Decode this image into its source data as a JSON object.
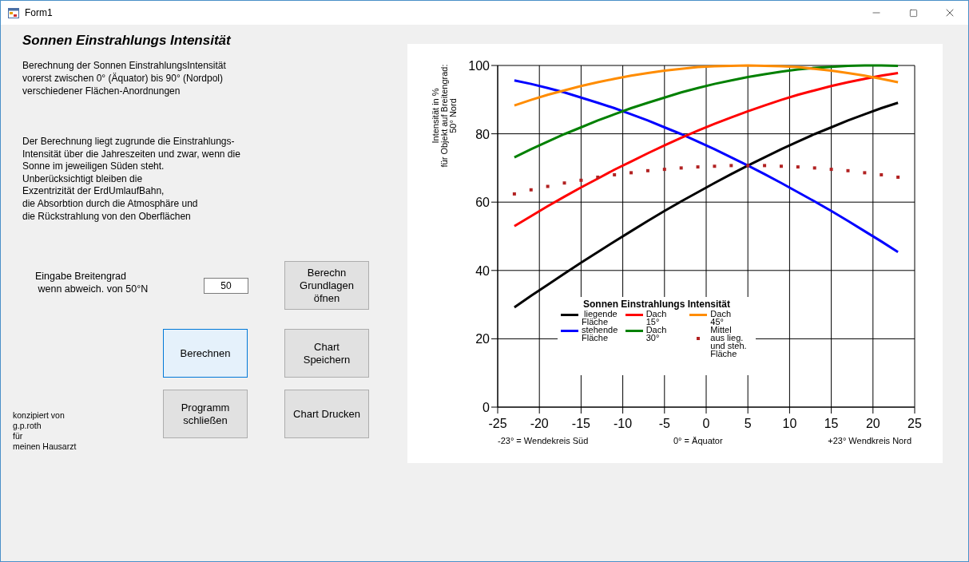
{
  "window": {
    "title": "Form1"
  },
  "heading": "Sonnen Einstrahlungs Intensität",
  "intro": "Berechnung der Sonnen EinstrahlungsIntensität\nvorerst zwischen 0° (Äquator) bis 90° (Nordpol)\nverschiedener Flächen-Anordnungen",
  "description": "Der Berechnung liegt zugrunde die Einstrahlungs-\nIntensität über die Jahreszeiten und zwar, wenn die\nSonne  im jeweiligen Süden steht.\nUnberücksichtigt bleiben die\nExzentrizität der ErdUmlaufBahn,\ndie Absorbtion durch die Atmosphäre und\ndie Rückstrahlung von den Oberflächen",
  "latitude": {
    "label": "Eingabe Breitengrad\n wenn abweich. von 50°N",
    "value": "50"
  },
  "buttons": [
    {
      "label": "Berechn\nGrundlagen\nöfnen",
      "focused": false
    },
    {
      "label": "Berechnen",
      "focused": true
    },
    {
      "label": "Chart\nSpeichern",
      "focused": false
    },
    {
      "label": "Programm\nschließen",
      "focused": false
    },
    {
      "label": "Chart Drucken",
      "focused": false
    }
  ],
  "credits": "konzipiert von\ng.p.roth\nfür\nmeinen Hausarzt",
  "chart": {
    "legend_title": "Sonnen Einstrahlungs Intensität",
    "notes": [
      "-23° = Wendekreis Süd",
      "0° = Äquator",
      "+23° Wendkreis Nord"
    ],
    "chart_data": {
      "type": "line",
      "grid": true,
      "legend": true,
      "ylabel": "Intensität in %\nfür Objekt auf Breitengrad:\n50° Nord",
      "xlim": [
        -25,
        25
      ],
      "ylim": [
        0,
        100
      ],
      "xticks": [
        -25,
        -20,
        -15,
        -10,
        -5,
        0,
        5,
        10,
        15,
        20,
        25
      ],
      "yticks": [
        0,
        20,
        40,
        60,
        80,
        100
      ],
      "x": [
        -23,
        -21,
        -19,
        -17,
        -15,
        -13,
        -11,
        -9,
        -7,
        -5,
        -3,
        -1,
        1,
        3,
        5,
        7,
        9,
        11,
        13,
        15,
        17,
        19,
        21,
        23
      ],
      "series": [
        {
          "name": " liegende\nFläche",
          "color": "#000000",
          "values": [
            29.2,
            32.6,
            35.8,
            39.1,
            42.3,
            45.4,
            48.5,
            51.5,
            54.5,
            57.4,
            60.2,
            62.9,
            65.6,
            68.2,
            70.7,
            73.1,
            75.5,
            77.7,
            79.9,
            81.9,
            83.9,
            85.7,
            87.5,
            89.1
          ]
        },
        {
          "name": "stehende\nFläche",
          "color": "#0000ff",
          "values": [
            95.6,
            94.6,
            93.4,
            92.1,
            90.6,
            89.1,
            87.5,
            85.7,
            83.9,
            81.9,
            79.9,
            77.7,
            75.5,
            73.1,
            70.7,
            68.2,
            65.6,
            62.9,
            60.2,
            57.4,
            54.5,
            51.5,
            48.5,
            45.4
          ]
        },
        {
          "name": "Dach\n15°",
          "color": "#ff0000",
          "values": [
            53.0,
            55.9,
            58.8,
            61.6,
            64.3,
            66.9,
            69.5,
            71.9,
            74.3,
            76.6,
            78.8,
            80.9,
            82.9,
            84.8,
            86.6,
            88.3,
            89.9,
            91.4,
            92.7,
            94.0,
            95.1,
            96.1,
            97.0,
            97.8
          ]
        },
        {
          "name": "Dach\n30°",
          "color": "#008000",
          "values": [
            73.1,
            75.5,
            77.7,
            79.9,
            81.9,
            83.9,
            85.7,
            87.5,
            89.1,
            90.6,
            92.1,
            93.4,
            94.6,
            95.6,
            96.6,
            97.4,
            98.2,
            98.8,
            99.3,
            99.6,
            99.9,
            100.0,
            100.0,
            99.9
          ]
        },
        {
          "name": "Dach\n45°",
          "color": "#ff8c00",
          "values": [
            88.3,
            89.9,
            91.4,
            92.7,
            94.0,
            95.1,
            96.1,
            97.0,
            97.8,
            98.5,
            99.0,
            99.5,
            99.8,
            99.9,
            100.0,
            99.9,
            99.8,
            99.5,
            99.0,
            98.5,
            97.8,
            97.0,
            96.1,
            95.1
          ]
        },
        {
          "name": "Mittel\naus lieg.\nund steh.\nFläche",
          "color": "#b22222",
          "type": "scatter",
          "values": [
            62.4,
            63.6,
            64.6,
            65.6,
            66.4,
            67.3,
            68.0,
            68.6,
            69.2,
            69.6,
            70.0,
            70.3,
            70.5,
            70.7,
            70.7,
            70.7,
            70.5,
            70.3,
            70.0,
            69.6,
            69.2,
            68.6,
            68.0,
            67.3
          ]
        }
      ]
    }
  }
}
